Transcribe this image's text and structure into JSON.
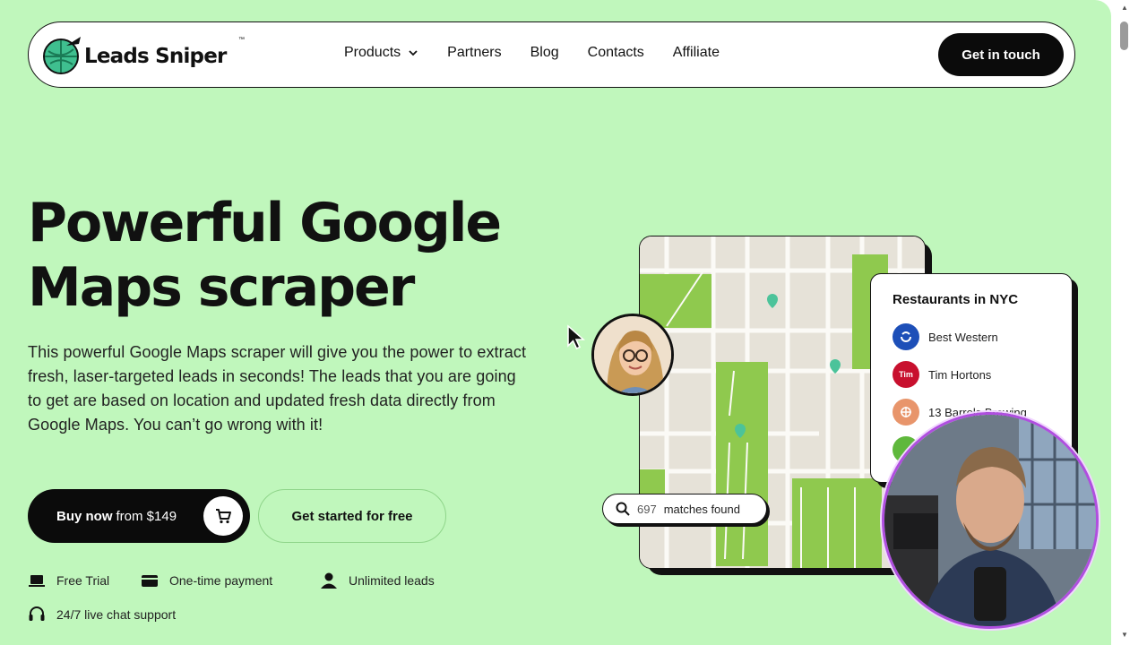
{
  "brand": {
    "name": "Leads Sniper",
    "tm": "™"
  },
  "nav": {
    "items": [
      "Products",
      "Partners",
      "Blog",
      "Contacts",
      "Affiliate"
    ],
    "cta": "Get in touch"
  },
  "hero": {
    "title": "Powerful Google Maps scraper",
    "description": "This powerful Google Maps scraper will give you the power to extract fresh, laser-targeted leads in seconds! The leads that you are going to get are based on location and updated fresh data directly from Google Maps. You can’t go wrong with it!",
    "buy_label": "Buy now",
    "buy_price": "from $149",
    "free_label": "Get started for free"
  },
  "features": [
    "Free Trial",
    "One-time payment",
    "Unlimited leads",
    "24/7 live chat support"
  ],
  "card": {
    "title": "Restaurants in NYC",
    "rows": [
      {
        "name": "Best Western",
        "color": "#1d4fb8",
        "icon": "bw-logo"
      },
      {
        "name": "Tim Hortons",
        "color": "#c8102e",
        "icon": "tim-logo",
        "abbr": "Tim"
      },
      {
        "name": "13 Barrels Brewing",
        "color": "#e8956b",
        "icon": "barrel-logo"
      }
    ]
  },
  "matches": {
    "count": "697",
    "label": "matches found"
  },
  "colors": {
    "page_bg": "#c0f7bc",
    "accent_green": "#8fc94e",
    "dark": "#0b0b0b"
  }
}
